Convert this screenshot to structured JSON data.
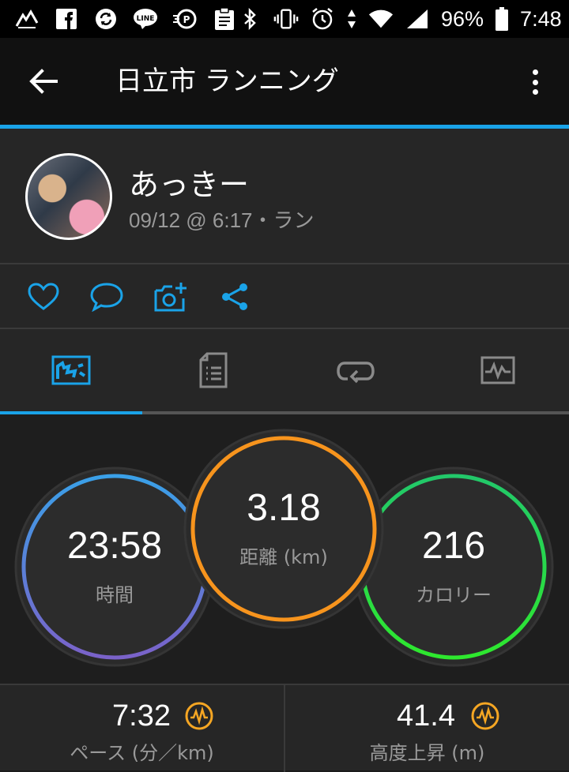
{
  "status_bar": {
    "battery": "96%",
    "time": "7:48",
    "left_icons": [
      "weather-icon",
      "facebook-icon",
      "sync-icon",
      "line-icon",
      "dpoint-icon",
      "clipboard-icon"
    ],
    "right_icons": [
      "bluetooth-icon",
      "vibrate-icon",
      "alarm-icon",
      "data-arrows-icon",
      "wifi-icon",
      "signal-icon",
      "battery-icon"
    ]
  },
  "app_bar": {
    "title": "日立市 ランニング"
  },
  "profile": {
    "name": "あっきー",
    "meta": "09/12 @ 6:17・ラン"
  },
  "actions": [
    "like-icon",
    "comment-icon",
    "add-photo-icon",
    "share-icon"
  ],
  "tabs": [
    {
      "id": "overview",
      "icon": "map-overview-icon",
      "active": true
    },
    {
      "id": "details",
      "icon": "document-list-icon",
      "active": false
    },
    {
      "id": "laps",
      "icon": "loop-icon",
      "active": false
    },
    {
      "id": "charts",
      "icon": "activity-chart-icon",
      "active": false
    }
  ],
  "stats": {
    "time": {
      "value": "23:58",
      "label": "時間"
    },
    "distance": {
      "value": "3.18",
      "label": "距離 (km)"
    },
    "calories": {
      "value": "216",
      "label": "カロリー"
    }
  },
  "bottom_stats": {
    "pace": {
      "value": "7:32",
      "label": "ペース (分／km)"
    },
    "elevation": {
      "value": "41.4",
      "label": "高度上昇 (m)"
    }
  },
  "colors": {
    "accent": "#1aa3e8",
    "distance_ring": "#f7941d",
    "time_ring_start": "#3aa0e8",
    "time_ring_end": "#7a62c9",
    "calories_ring": "#2ee85a",
    "badge": "#f5a623"
  }
}
